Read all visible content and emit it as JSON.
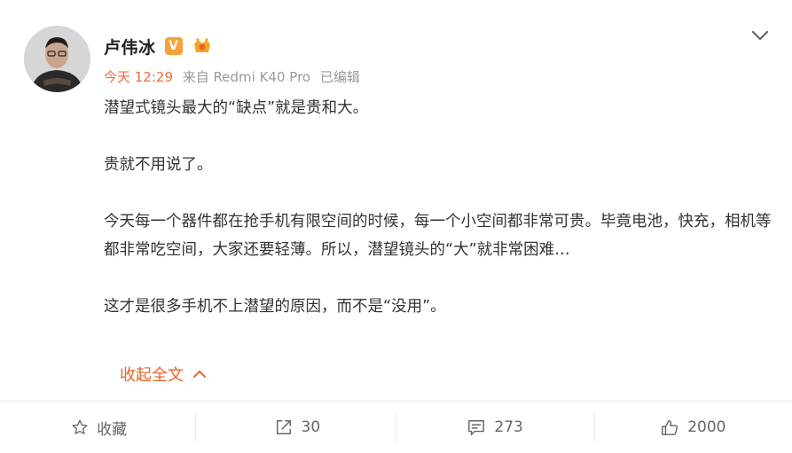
{
  "post": {
    "author": {
      "name": "卢伟冰",
      "verified_badge": "V"
    },
    "meta": {
      "time": "今天 12:29",
      "source": "来自 Redmi K40 Pro",
      "edited": "已编辑"
    },
    "paragraphs": [
      "潜望式镜头最大的“缺点”就是贵和大。",
      "贵就不用说了。",
      "今天每一个器件都在抢手机有限空间的时候，每一个小空间都非常可贵。毕竟电池，快充，相机等都非常吃空间，大家还要轻薄。所以，潜望镜头的“大”就非常困难…",
      "这才是很多手机不上潜望的原因，而不是“没用”。"
    ],
    "collapse_label": "收起全文"
  },
  "actions": {
    "favorite": {
      "label": "收藏",
      "icon": "star-icon"
    },
    "repost": {
      "count": "30",
      "icon": "share-icon"
    },
    "comment": {
      "count": "273",
      "icon": "comment-icon"
    },
    "like": {
      "count": "2000",
      "icon": "thumbs-up-icon"
    }
  },
  "colors": {
    "accent": "#e5662c",
    "time": "#f26b3a",
    "meta": "#999999",
    "text": "#333333"
  }
}
